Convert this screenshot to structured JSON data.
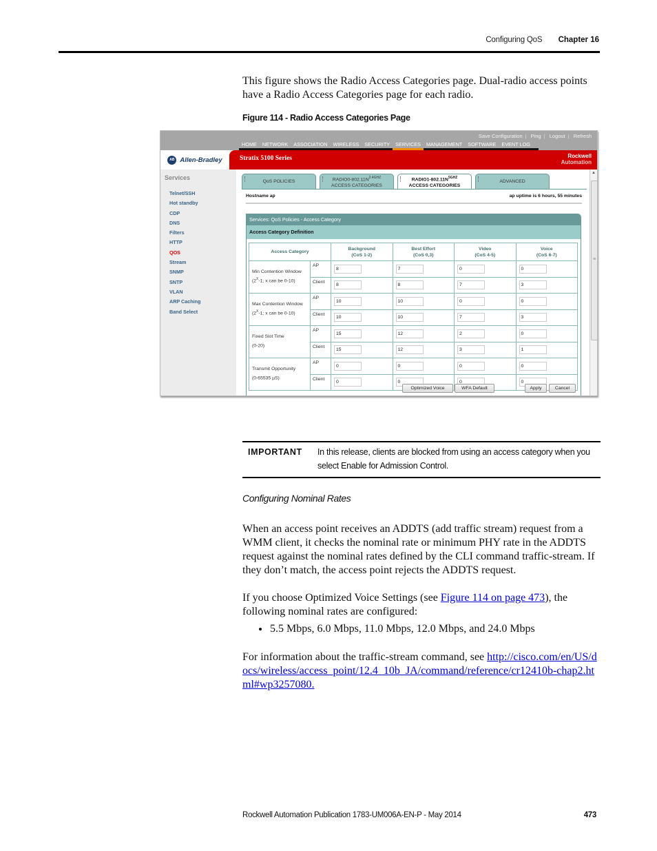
{
  "running_header": {
    "section": "Configuring QoS",
    "chapter": "Chapter 16"
  },
  "intro_text": "This figure shows the Radio Access Categories page. Dual-radio access points have a Radio Access Categories page for each radio.",
  "figure_caption": "Figure 114 - Radio Access Categories Page",
  "screenshot": {
    "utility_links": [
      "Save Configuration",
      "Ping",
      "Logout",
      "Refresh"
    ],
    "nav": [
      "HOME",
      "NETWORK",
      "ASSOCIATION",
      "WIRELESS",
      "SECURITY",
      "SERVICES",
      "MANAGEMENT",
      "SOFTWARE",
      "EVENT LOG"
    ],
    "nav_active": "SERVICES",
    "logo_badge": "AB",
    "logo_text": "Allen-Bradley",
    "product": "Stratix 5100 Series",
    "brand_line1": "Rockwell",
    "brand_line2": "Automation",
    "sidebar_title": "Services",
    "sidebar_items": [
      "Telnet/SSH",
      "Hot standby",
      "CDP",
      "DNS",
      "Filters",
      "HTTP",
      "QOS",
      "Stream",
      "SNMP",
      "SNTP",
      "VLAN",
      "ARP Caching",
      "Band Select"
    ],
    "sidebar_active": "QOS",
    "tabs": [
      {
        "line1": "QoS POLICIES",
        "sup": "",
        "line2": ""
      },
      {
        "line1": "RADIO0-802.11N",
        "sup": "2.4GHZ",
        "line2": "ACCESS CATEGORIES"
      },
      {
        "line1": "RADIO1-802.11N",
        "sup": "5GHZ",
        "line2": "ACCESS CATEGORIES"
      },
      {
        "line1": "ADVANCED",
        "sup": "",
        "line2": ""
      }
    ],
    "active_tab": 2,
    "hostname_label": "Hostname  ap",
    "uptime": "ap uptime is 6 hours, 55 minutes",
    "panel_title": "Services: QoS Policies - Access Category",
    "panel_subtitle": "Access Category Definition",
    "table": {
      "header_first": "Access Category",
      "columns": [
        {
          "name": "Background",
          "cos": "(CoS 1-2)"
        },
        {
          "name": "Best Effort",
          "cos": "(CoS 0,3)"
        },
        {
          "name": "Video",
          "cos": "(CoS 4-5)"
        },
        {
          "name": "Voice",
          "cos": "(CoS 6-7)"
        }
      ],
      "params": [
        {
          "label": "Min Contention Window",
          "note_pre": "(2",
          "note_sup": "X",
          "note_post": "-1; x can be 0-10)",
          "rows": [
            {
              "role": "AP",
              "values": [
                "8",
                "7",
                "0",
                "0"
              ]
            },
            {
              "role": "Client",
              "values": [
                "8",
                "8",
                "7",
                "3"
              ]
            }
          ]
        },
        {
          "label": "Max Contention Window",
          "note_pre": "(2",
          "note_sup": "X",
          "note_post": "-1; x can be 0-10)",
          "rows": [
            {
              "role": "AP",
              "values": [
                "10",
                "10",
                "0",
                "0"
              ]
            },
            {
              "role": "Client",
              "values": [
                "10",
                "10",
                "7",
                "3"
              ]
            }
          ]
        },
        {
          "label": "Fixed Slot Time",
          "note_pre": "(0-20)",
          "note_sup": "",
          "note_post": "",
          "rows": [
            {
              "role": "AP",
              "values": [
                "15",
                "12",
                "2",
                "0"
              ]
            },
            {
              "role": "Client",
              "values": [
                "15",
                "12",
                "3",
                "1"
              ]
            }
          ]
        },
        {
          "label": "Transmit Opportunity",
          "note_pre": "(0-65535 µS)",
          "note_sup": "",
          "note_post": "",
          "rows": [
            {
              "role": "AP",
              "values": [
                "0",
                "0",
                "0",
                "0"
              ]
            },
            {
              "role": "Client",
              "values": [
                "0",
                "0",
                "0",
                "0"
              ]
            }
          ]
        }
      ]
    },
    "buttons": {
      "optimized_voice": "Optimized Voice",
      "wfa_default": "WFA Default",
      "apply": "Apply",
      "cancel": "Cancel"
    }
  },
  "important": {
    "label": "IMPORTANT",
    "text": "In this release, clients are blocked from using an access category when you select Enable for Admission Control."
  },
  "subheading": "Configuring Nominal Rates",
  "para1": "When an access point receives an ADDTS (add traffic stream) request from a WMM client, it checks the nominal rate or minimum PHY rate in the ADDTS request against the nominal rates defined by the CLI command traffic-stream. If they don’t match, the access point rejects the ADDTS request.",
  "para2": {
    "pre": "If you choose Optimized Voice Settings (see ",
    "link": "Figure 114 on page 473",
    "post": "), the following nominal rates are configured:"
  },
  "bullet": "5.5 Mbps, 6.0 Mbps, 11.0 Mbps, 12.0 Mbps, and 24.0 Mbps",
  "para3": {
    "pre": "For information about the traffic-stream command, see ",
    "link": "http://cisco.com/en/US/docs/wireless/access_point/12.4_10b_JA/command/reference/cr12410b-chap2.html#wp3257080."
  },
  "footer": {
    "publication": "Rockwell Automation Publication 1783-UM006A-EN-P - May 2014",
    "page": "473"
  }
}
